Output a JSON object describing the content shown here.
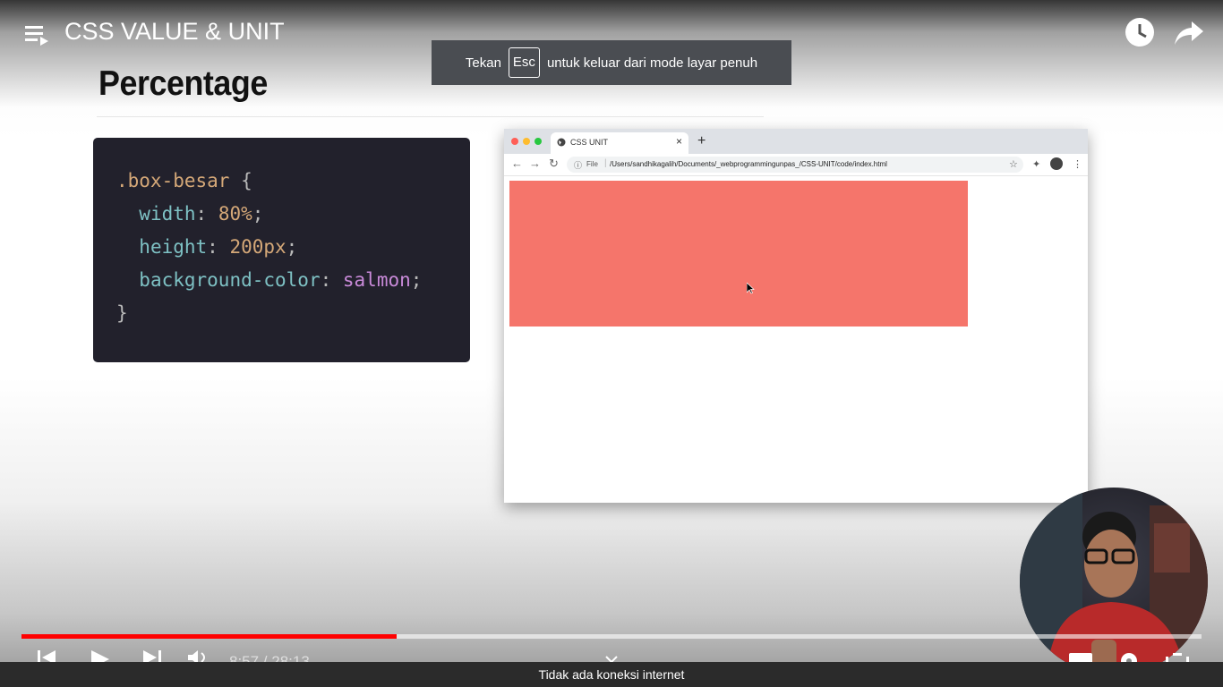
{
  "player": {
    "title": "CSS VALUE & UNIT",
    "progress_fraction": 0.318,
    "time_label": "8:57 / 28:13"
  },
  "fullscreen_toast": {
    "prefix": "Tekan",
    "key": "Esc",
    "suffix": "untuk keluar dari mode layar penuh"
  },
  "slide": {
    "heading": "Percentage",
    "code": {
      "selector": ".box-besar",
      "open_brace": "{",
      "close_brace": "}",
      "declarations": [
        {
          "property": "width",
          "value": "80%"
        },
        {
          "property": "height",
          "value": "200px"
        },
        {
          "property": "background-color",
          "value": "salmon"
        }
      ]
    },
    "browser": {
      "tab_title": "CSS UNIT",
      "tab_close": "×",
      "new_tab": "+",
      "address_info": "ⓘ",
      "address_scheme": "File",
      "address_separator": "|",
      "address_path": "/Users/sandhikagalih/Documents/_webprogrammingunpas_/CSS-UNIT/code/index.html",
      "box_color": "#f5756b"
    }
  },
  "status_bar": {
    "message": "Tidak ada koneksi internet"
  },
  "colors": {
    "progress": "#ff0000",
    "code_bg": "#22212c",
    "salmon": "#f5756b"
  },
  "icons": [
    "playlist-icon",
    "watch-later-icon",
    "share-icon",
    "previous-icon",
    "play-icon",
    "next-icon",
    "volume-icon",
    "chevron-down-icon",
    "subtitles-icon",
    "settings-icon",
    "fullscreen-icon"
  ]
}
